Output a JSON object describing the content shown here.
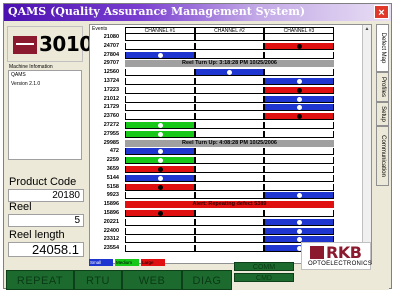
{
  "window": {
    "title": "QAMS (Quality Assurance Management System)",
    "close_label": "×"
  },
  "left": {
    "model": "3010",
    "info_label": "Machine Infomation",
    "info_lines": [
      "QAMS",
      "Version 2.1.0"
    ],
    "product_code_label": "Product Code",
    "product_code": "20180",
    "reel_label": "Reel",
    "reel": "5",
    "reel_length_label": "Reel length",
    "reel_length": "24058.1"
  },
  "grid": {
    "events_label": "Events",
    "channels": [
      "CHANNEL #1",
      "CHANNEL #2",
      "CHANNEL #3"
    ],
    "rows": [
      {
        "ev": "21080",
        "type": "cells",
        "c": [
          "",
          "",
          ""
        ]
      },
      {
        "ev": "24707",
        "type": "cells",
        "c": [
          "",
          "",
          "red"
        ]
      },
      {
        "ev": "27804",
        "type": "cells",
        "c": [
          "blue",
          "",
          ""
        ]
      },
      {
        "ev": "29707",
        "type": "banner",
        "text": "Reel Turn Up: 3:18:28 PM 10/25/2006",
        "color": "#a0a0a0"
      },
      {
        "ev": "12560",
        "type": "cells",
        "c": [
          "",
          "blue",
          ""
        ]
      },
      {
        "ev": "13724",
        "type": "cells",
        "c": [
          "",
          "",
          "blue"
        ]
      },
      {
        "ev": "17223",
        "type": "cells",
        "c": [
          "",
          "",
          "red"
        ]
      },
      {
        "ev": "21012",
        "type": "cells",
        "c": [
          "",
          "",
          "blue"
        ]
      },
      {
        "ev": "21729",
        "type": "cells",
        "c": [
          "",
          "",
          "blue"
        ]
      },
      {
        "ev": "23760",
        "type": "cells",
        "c": [
          "",
          "",
          "red"
        ]
      },
      {
        "ev": "27272",
        "type": "cells",
        "c": [
          "green",
          "",
          ""
        ]
      },
      {
        "ev": "27955",
        "type": "cells",
        "c": [
          "green",
          "",
          ""
        ]
      },
      {
        "ev": "29985",
        "type": "banner",
        "text": "Reel Turn Up: 4:08:28 PM 10/25/2006",
        "color": "#a0a0a0"
      },
      {
        "ev": "472",
        "type": "cells",
        "c": [
          "blue",
          "",
          ""
        ]
      },
      {
        "ev": "2259",
        "type": "cells",
        "c": [
          "green",
          "",
          ""
        ]
      },
      {
        "ev": "3659",
        "type": "cells",
        "c": [
          "red",
          "",
          ""
        ]
      },
      {
        "ev": "5144",
        "type": "cells",
        "c": [
          "blue",
          "",
          ""
        ]
      },
      {
        "ev": "5158",
        "type": "cells",
        "c": [
          "red",
          "",
          ""
        ]
      },
      {
        "ev": "9923",
        "type": "cells",
        "c": [
          "",
          "",
          "blue"
        ]
      },
      {
        "ev": "15896",
        "type": "banner",
        "text": "Alert: Repeating defect 5389",
        "color": "#e01010"
      },
      {
        "ev": "15896",
        "type": "cells",
        "c": [
          "red",
          "",
          ""
        ]
      },
      {
        "ev": "20221",
        "type": "cells",
        "c": [
          "",
          "",
          "blue"
        ]
      },
      {
        "ev": "22400",
        "type": "cells",
        "c": [
          "",
          "",
          "blue"
        ]
      },
      {
        "ev": "23312",
        "type": "cells",
        "c": [
          "",
          "",
          "blue"
        ]
      },
      {
        "ev": "23554",
        "type": "cells",
        "c": [
          "",
          "",
          "blue"
        ]
      }
    ]
  },
  "legend": [
    {
      "label": "Small",
      "color": "#1f35d0"
    },
    {
      "label": "Medium",
      "color": "#18c818"
    },
    {
      "label": "Large",
      "color": "#e01010"
    }
  ],
  "colors": {
    "blue": "#1f35d0",
    "green": "#18c818",
    "red": "#e01010",
    "dot_dark": "#000000",
    "dot_light": "#ffffff"
  },
  "tabs": [
    "Defect Map",
    "Profiles",
    "Setup",
    "Communication"
  ],
  "buttons": {
    "repeat": "REPEAT",
    "rtu": "RTU",
    "web": "WEB",
    "diag": "DIAG",
    "comm": "COMM",
    "cmd": "CMD"
  },
  "brand": {
    "name": "RKB",
    "sub": "OPTOELECTRONICS"
  }
}
